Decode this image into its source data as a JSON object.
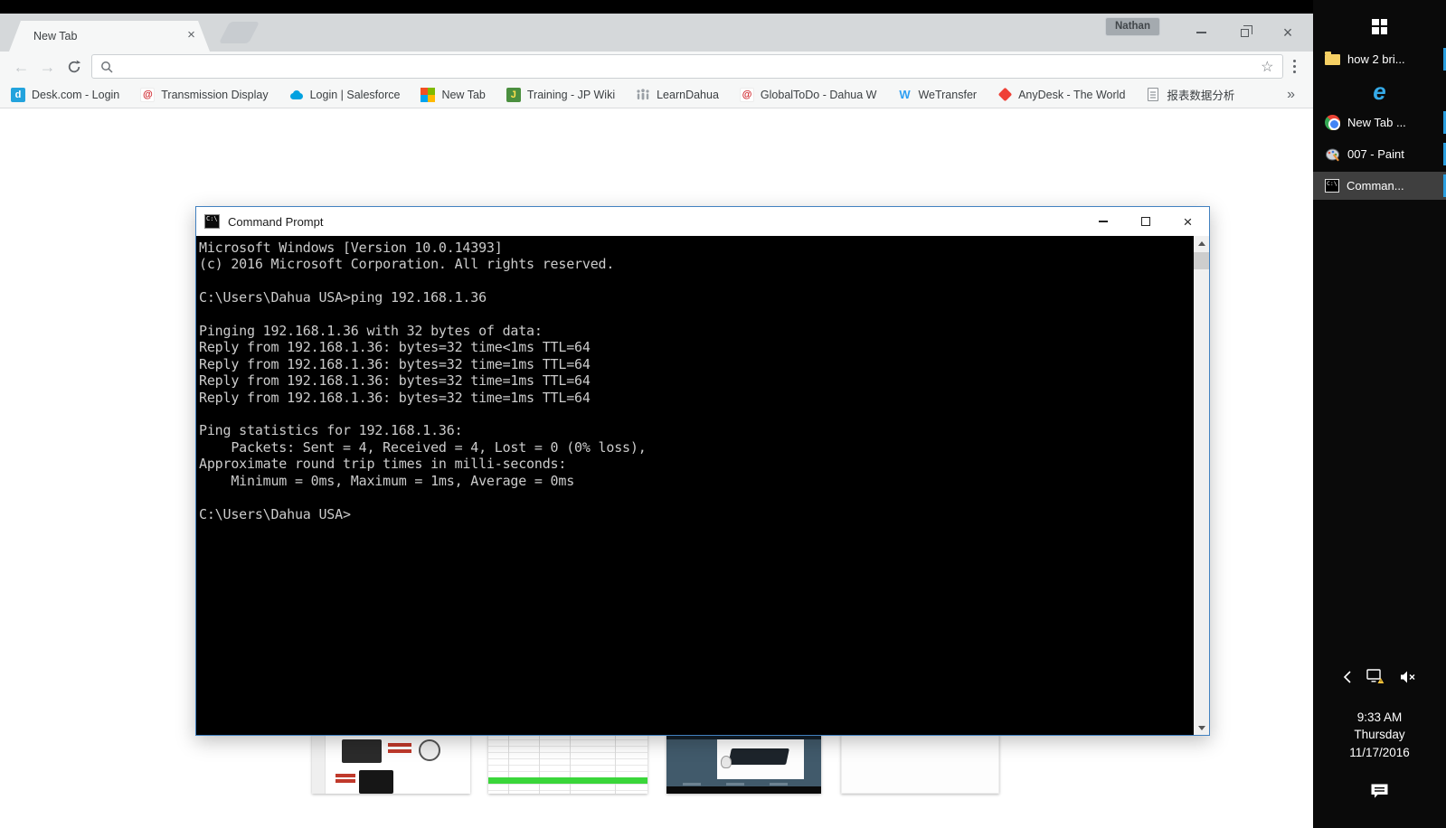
{
  "browser": {
    "tab": {
      "title": "New Tab"
    },
    "profile": "Nathan",
    "omnibox": {
      "value": ""
    },
    "bookmarks": [
      {
        "icon": "desk-icon",
        "label": "Desk.com - Login"
      },
      {
        "icon": "dahua-icon",
        "label": "Transmission Display"
      },
      {
        "icon": "salesforce-cloud-icon",
        "label": "Login | Salesforce"
      },
      {
        "icon": "microsoft-icon",
        "label": "New Tab"
      },
      {
        "icon": "wiki-icon",
        "label": "Training - JP Wiki"
      },
      {
        "icon": "people-icon",
        "label": "LearnDahua"
      },
      {
        "icon": "dahua-icon",
        "label": "GlobalToDo - Dahua W"
      },
      {
        "icon": "wetransfer-icon",
        "label": "WeTransfer"
      },
      {
        "icon": "anydesk-icon",
        "label": "AnyDesk - The World"
      },
      {
        "icon": "document-icon",
        "label": "报表数据分析"
      }
    ],
    "bookmarks_overflow": "»"
  },
  "terminal": {
    "title": "Command Prompt",
    "lines": [
      "Microsoft Windows [Version 10.0.14393]",
      "(c) 2016 Microsoft Corporation. All rights reserved.",
      "",
      "C:\\Users\\Dahua USA>ping 192.168.1.36",
      "",
      "Pinging 192.168.1.36 with 32 bytes of data:",
      "Reply from 192.168.1.36: bytes=32 time<1ms TTL=64",
      "Reply from 192.168.1.36: bytes=32 time=1ms TTL=64",
      "Reply from 192.168.1.36: bytes=32 time=1ms TTL=64",
      "Reply from 192.168.1.36: bytes=32 time=1ms TTL=64",
      "",
      "Ping statistics for 192.168.1.36:",
      "    Packets: Sent = 4, Received = 4, Lost = 0 (0% loss),",
      "Approximate round trip times in milli-seconds:",
      "    Minimum = 0ms, Maximum = 1ms, Average = 0ms",
      "",
      "C:\\Users\\Dahua USA>"
    ]
  },
  "taskbar": {
    "items": [
      {
        "icon": "folder-icon",
        "label": "how 2 bri..."
      },
      {
        "icon": "internet-explorer-icon",
        "label": ""
      },
      {
        "icon": "chrome-icon",
        "label": "New Tab ..."
      },
      {
        "icon": "paint-icon",
        "label": "007 - Paint"
      },
      {
        "icon": "command-prompt-icon",
        "label": "Comman..."
      }
    ],
    "clock": {
      "time": "9:33 AM",
      "day": "Thursday",
      "date": "11/17/2016"
    }
  },
  "colors": {
    "accent_blue": "#2a9fe0",
    "cmd_window_border": "#4281c0",
    "terminal_background": "#000000",
    "terminal_text": "#cbcbcb",
    "taskbar_background": "#0a0a0a",
    "tab_strip": "#d5d8da"
  }
}
